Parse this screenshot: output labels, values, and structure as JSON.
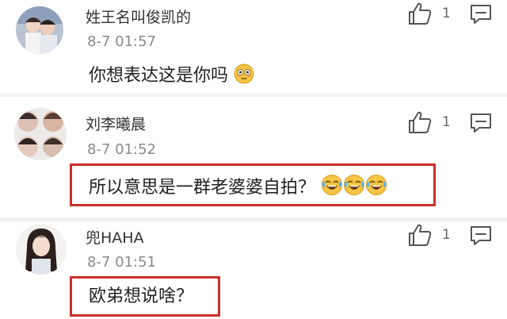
{
  "comments": [
    {
      "username": "姓王名叫俊凯的",
      "timestamp": "8-7 01:57",
      "text": "你想表达这是你吗",
      "emoji": [
        "flushed-face"
      ],
      "likes": "1"
    },
    {
      "username": "刘李曦晨",
      "timestamp": "8-7 01:52",
      "text": "所以意思是一群老婆婆自拍？",
      "emoji": [
        "tears-of-joy",
        "tears-of-joy",
        "tears-of-joy"
      ],
      "likes": "1"
    },
    {
      "username": "兜HAHA",
      "timestamp": "8-7 01:51",
      "text": "欧弟想说啥？",
      "emoji": [],
      "likes": "1"
    }
  ],
  "colors": {
    "highlight_box": "#c8302a",
    "divider": "#f2f2f2",
    "timestamp": "#8a8a8a"
  },
  "icons": [
    "thumbs-up-icon",
    "reply-icon",
    "flushed-face-emoji",
    "tears-of-joy-emoji"
  ]
}
